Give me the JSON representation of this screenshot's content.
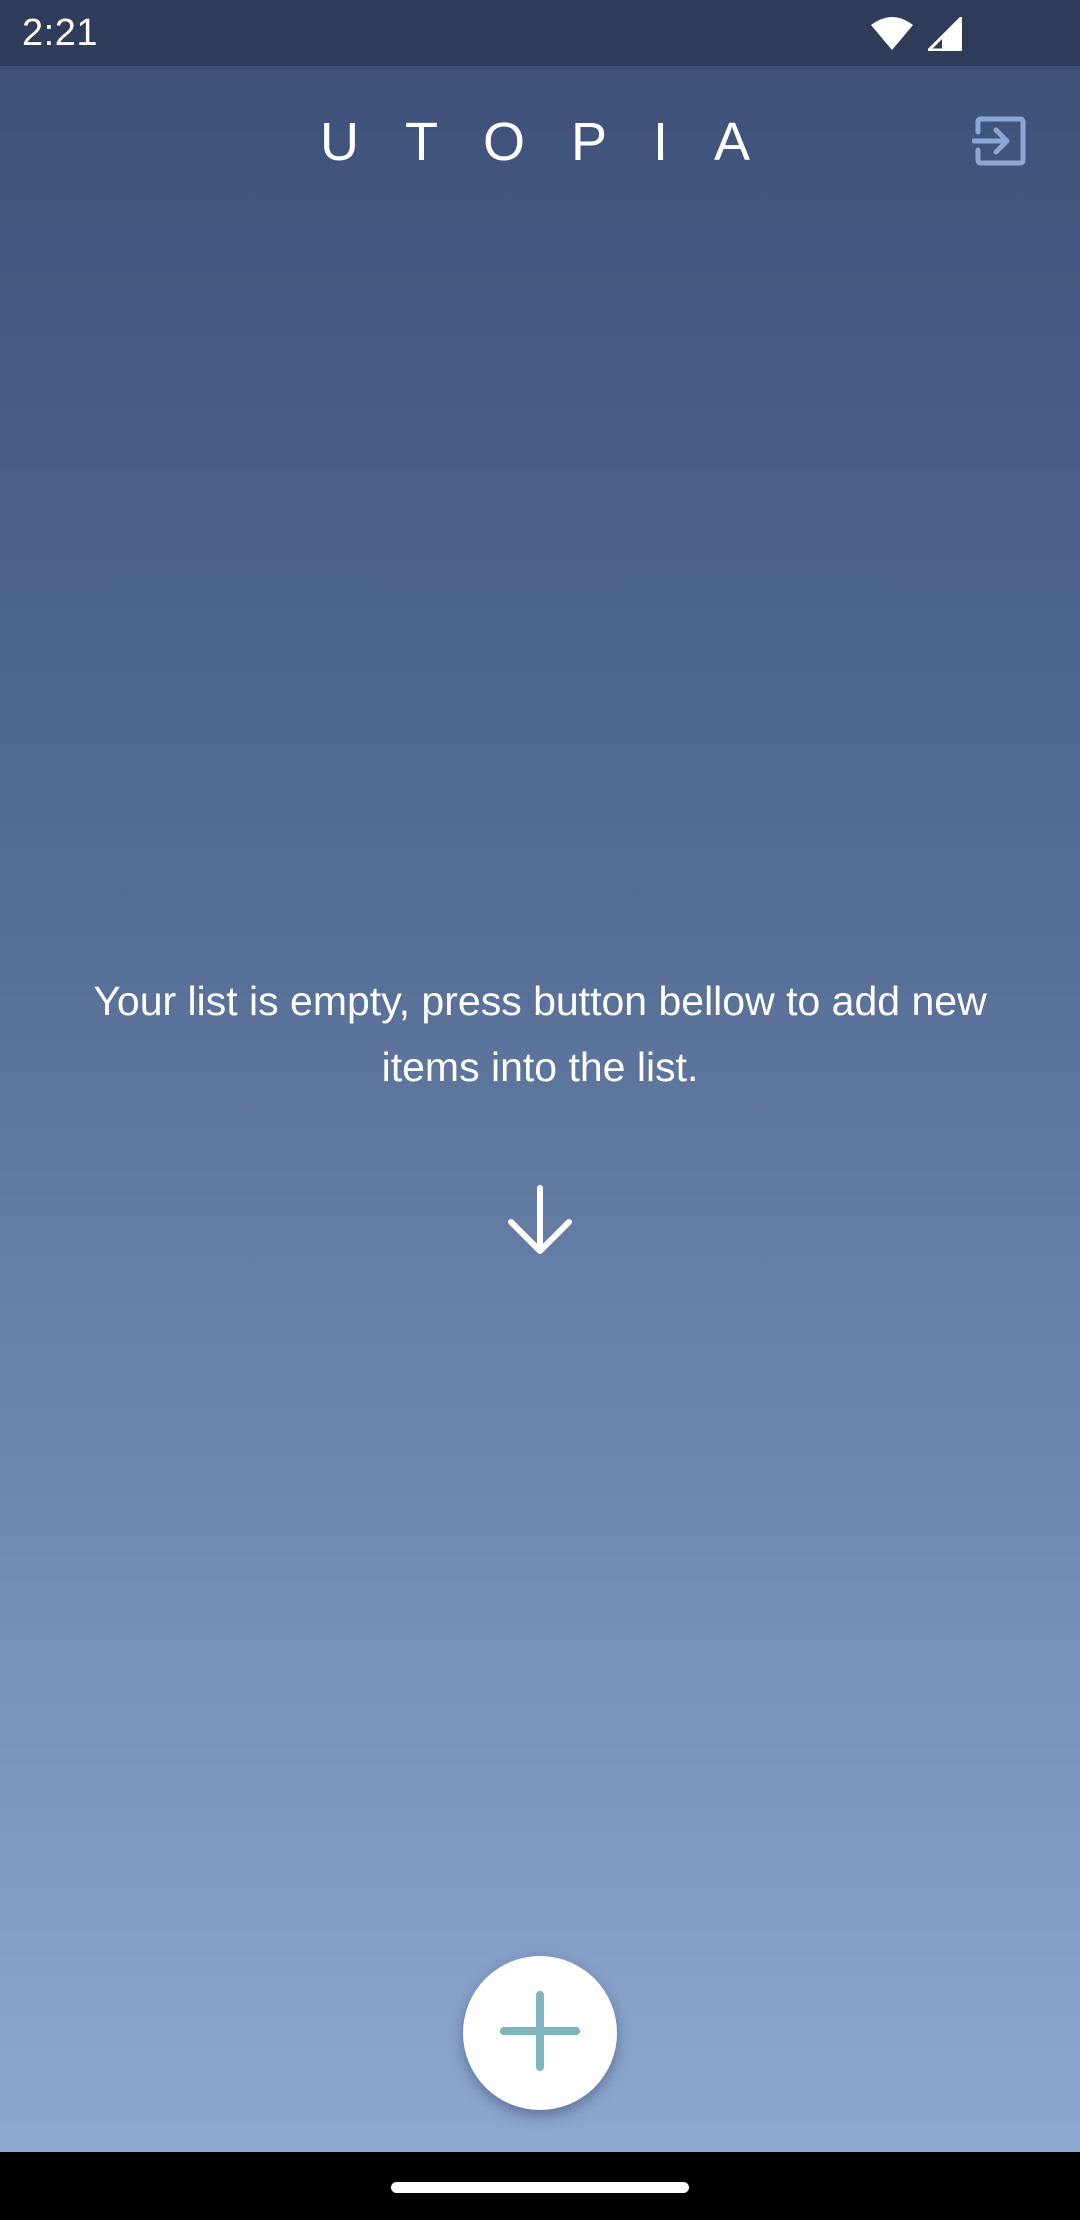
{
  "status_bar": {
    "time": "2:21",
    "icons": [
      "wifi-icon",
      "cell-signal-icon"
    ]
  },
  "header": {
    "title": "UTOPIA",
    "logout_icon": "logout-icon"
  },
  "empty_state": {
    "message": "Your list is empty, press button bellow to add new items into the list.",
    "arrow_icon": "arrow-down-icon"
  },
  "fab": {
    "icon": "plus-icon",
    "icon_color": "#7bb7bd"
  },
  "colors": {
    "status_bar": "#2f3d5a",
    "gradient_top": "#3c4f77",
    "gradient_bottom": "#8ea8d0",
    "logout_icon": "#8ea6d6"
  }
}
